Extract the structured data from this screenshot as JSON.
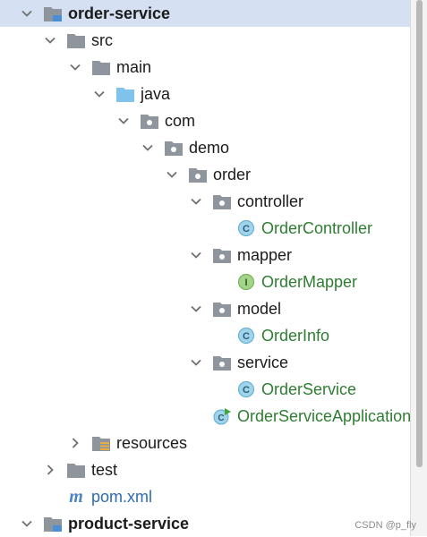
{
  "tree": {
    "items": [
      {
        "label": "order-service",
        "bold": true,
        "selected": true,
        "chevron": "expanded",
        "icon": "module-folder-icon",
        "color": "default"
      },
      {
        "label": "src",
        "chevron": "expanded",
        "icon": "folder-icon",
        "color": "default"
      },
      {
        "label": "main",
        "chevron": "expanded",
        "icon": "folder-icon",
        "color": "default"
      },
      {
        "label": "java",
        "chevron": "expanded",
        "icon": "source-root-folder-icon",
        "color": "default"
      },
      {
        "label": "com",
        "chevron": "expanded",
        "icon": "package-icon",
        "color": "default"
      },
      {
        "label": "demo",
        "chevron": "expanded",
        "icon": "package-icon",
        "color": "default"
      },
      {
        "label": "order",
        "chevron": "expanded",
        "icon": "package-icon",
        "color": "default"
      },
      {
        "label": "controller",
        "chevron": "expanded",
        "icon": "package-icon",
        "color": "default"
      },
      {
        "label": "OrderController",
        "chevron": "none",
        "icon": "class-icon",
        "color": "green"
      },
      {
        "label": "mapper",
        "chevron": "expanded",
        "icon": "package-icon",
        "color": "default"
      },
      {
        "label": "OrderMapper",
        "chevron": "none",
        "icon": "interface-icon",
        "color": "green"
      },
      {
        "label": "model",
        "chevron": "expanded",
        "icon": "package-icon",
        "color": "default"
      },
      {
        "label": "OrderInfo",
        "chevron": "none",
        "icon": "class-icon",
        "color": "green"
      },
      {
        "label": "service",
        "chevron": "expanded",
        "icon": "package-icon",
        "color": "default"
      },
      {
        "label": "OrderService",
        "chevron": "none",
        "icon": "class-icon",
        "color": "green"
      },
      {
        "label": "OrderServiceApplication",
        "chevron": "none",
        "icon": "spring-boot-app-icon",
        "color": "green"
      },
      {
        "label": "resources",
        "chevron": "collapsed",
        "icon": "resources-folder-icon",
        "color": "default"
      },
      {
        "label": "test",
        "chevron": "collapsed",
        "icon": "folder-icon",
        "color": "default"
      },
      {
        "label": "pom.xml",
        "chevron": "none",
        "icon": "maven-icon",
        "color": "blue"
      },
      {
        "label": "product-service",
        "bold": true,
        "chevron": "expanded",
        "icon": "module-folder-icon",
        "color": "default"
      }
    ]
  },
  "colors": {
    "selection": "#d5e1f2",
    "class_green": "#2e7d32",
    "pom_blue": "#2f6bb5",
    "class_icon": "#9fd4ec",
    "interface_icon": "#a3d48a",
    "folder_gray": "#8e959d",
    "source_root_blue": "#7fc2ec"
  },
  "watermark": "CSDN @p_fly"
}
